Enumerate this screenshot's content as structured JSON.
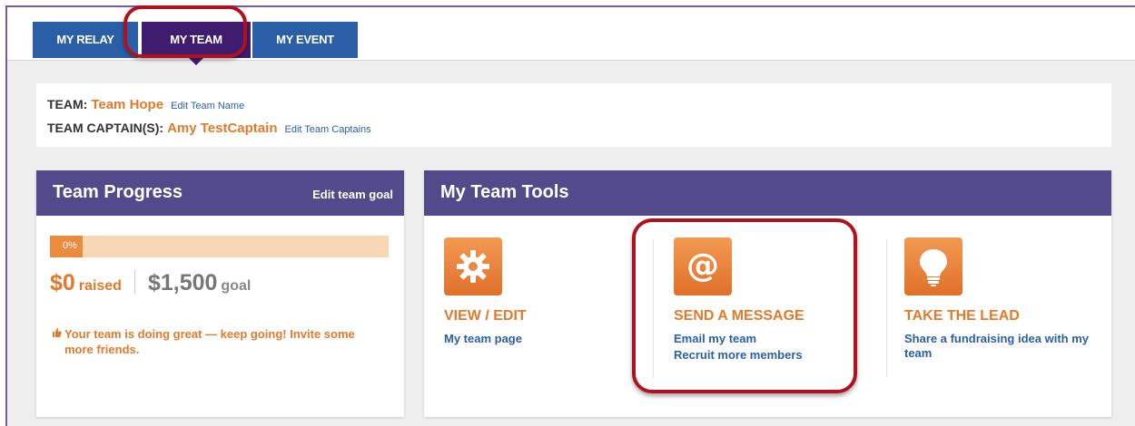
{
  "tabs": [
    {
      "label": "MY RELAY"
    },
    {
      "label": "MY TEAM"
    },
    {
      "label": "MY EVENT"
    }
  ],
  "team_info": {
    "team_label": "TEAM:",
    "team_name": "Team Hope",
    "edit_team_name": "Edit Team Name",
    "captain_label": "TEAM CAPTAIN(S):",
    "captain_name": "Amy TestCaptain",
    "edit_captains": "Edit Team Captains"
  },
  "progress": {
    "title": "Team Progress",
    "edit_goal": "Edit team goal",
    "percent_label": "0%",
    "percent": 0,
    "raised_amount": "$0",
    "raised_unit": "raised",
    "goal_amount": "$1,500",
    "goal_unit": "goal",
    "message": "Your team is doing great — keep going! Invite some more friends."
  },
  "tools": {
    "title": "My Team Tools",
    "items": [
      {
        "icon": "gear-icon",
        "title": "VIEW / EDIT",
        "links": [
          "My team page"
        ]
      },
      {
        "icon": "at-sign-icon",
        "title": "SEND A MESSAGE",
        "links": [
          "Email my team",
          "Recruit more members"
        ]
      },
      {
        "icon": "lightbulb-icon",
        "title": "TAKE THE LEAD",
        "links": [
          "Share a fundraising idea with my team"
        ]
      }
    ]
  },
  "colors": {
    "tab_blue": "#2a5fa8",
    "tab_active": "#3f1c6e",
    "header_purple": "#524a8a",
    "accent_orange": "#e37a2a",
    "link_blue": "#2a5fa8",
    "highlight_red": "#b0111e"
  }
}
